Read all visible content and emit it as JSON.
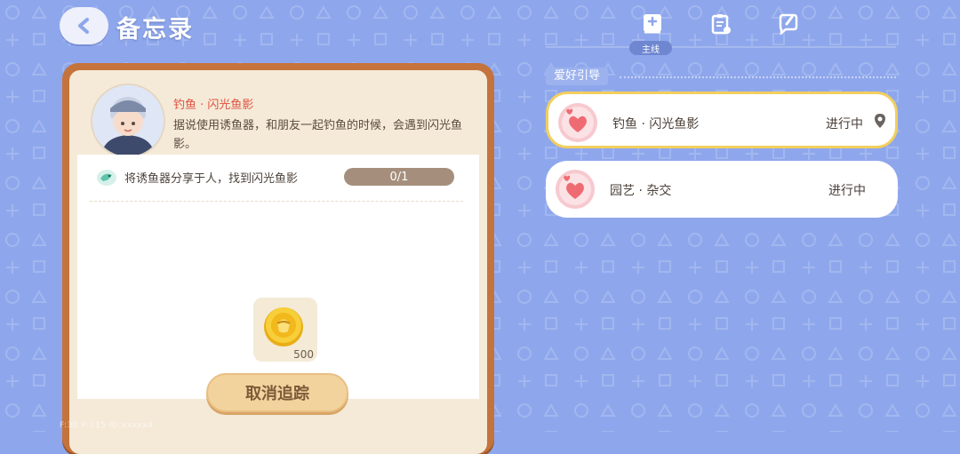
{
  "header": {
    "title": "备忘录"
  },
  "tabs": [
    {
      "label": "主线",
      "active": true
    }
  ],
  "quest_detail": {
    "name": "钓鱼 · 闪光鱼影",
    "description": "据说使用诱鱼器，和朋友一起钓鱼的时候，会遇到闪光鱼影。",
    "task": {
      "text": "将诱鱼器分享于人，找到闪光鱼影",
      "progress": "0/1"
    },
    "reward": {
      "count": "500",
      "icon": "gold-coin-icon"
    },
    "untrack_button": "取消追踪"
  },
  "section": {
    "title": "爱好引导"
  },
  "quest_list": [
    {
      "title": "钓鱼 · 闪光鱼影",
      "status": "进行中",
      "tracked": true
    },
    {
      "title": "园艺 · 杂交",
      "status": "进行中",
      "tracked": false
    }
  ],
  "debug_stats": "F:30 P:115 ID:xxxxx4",
  "colors": {
    "background": "#8ea7ec",
    "card_frame": "#c5733c",
    "quest_name": "#e0513f",
    "active_border": "#f2cf5e"
  }
}
